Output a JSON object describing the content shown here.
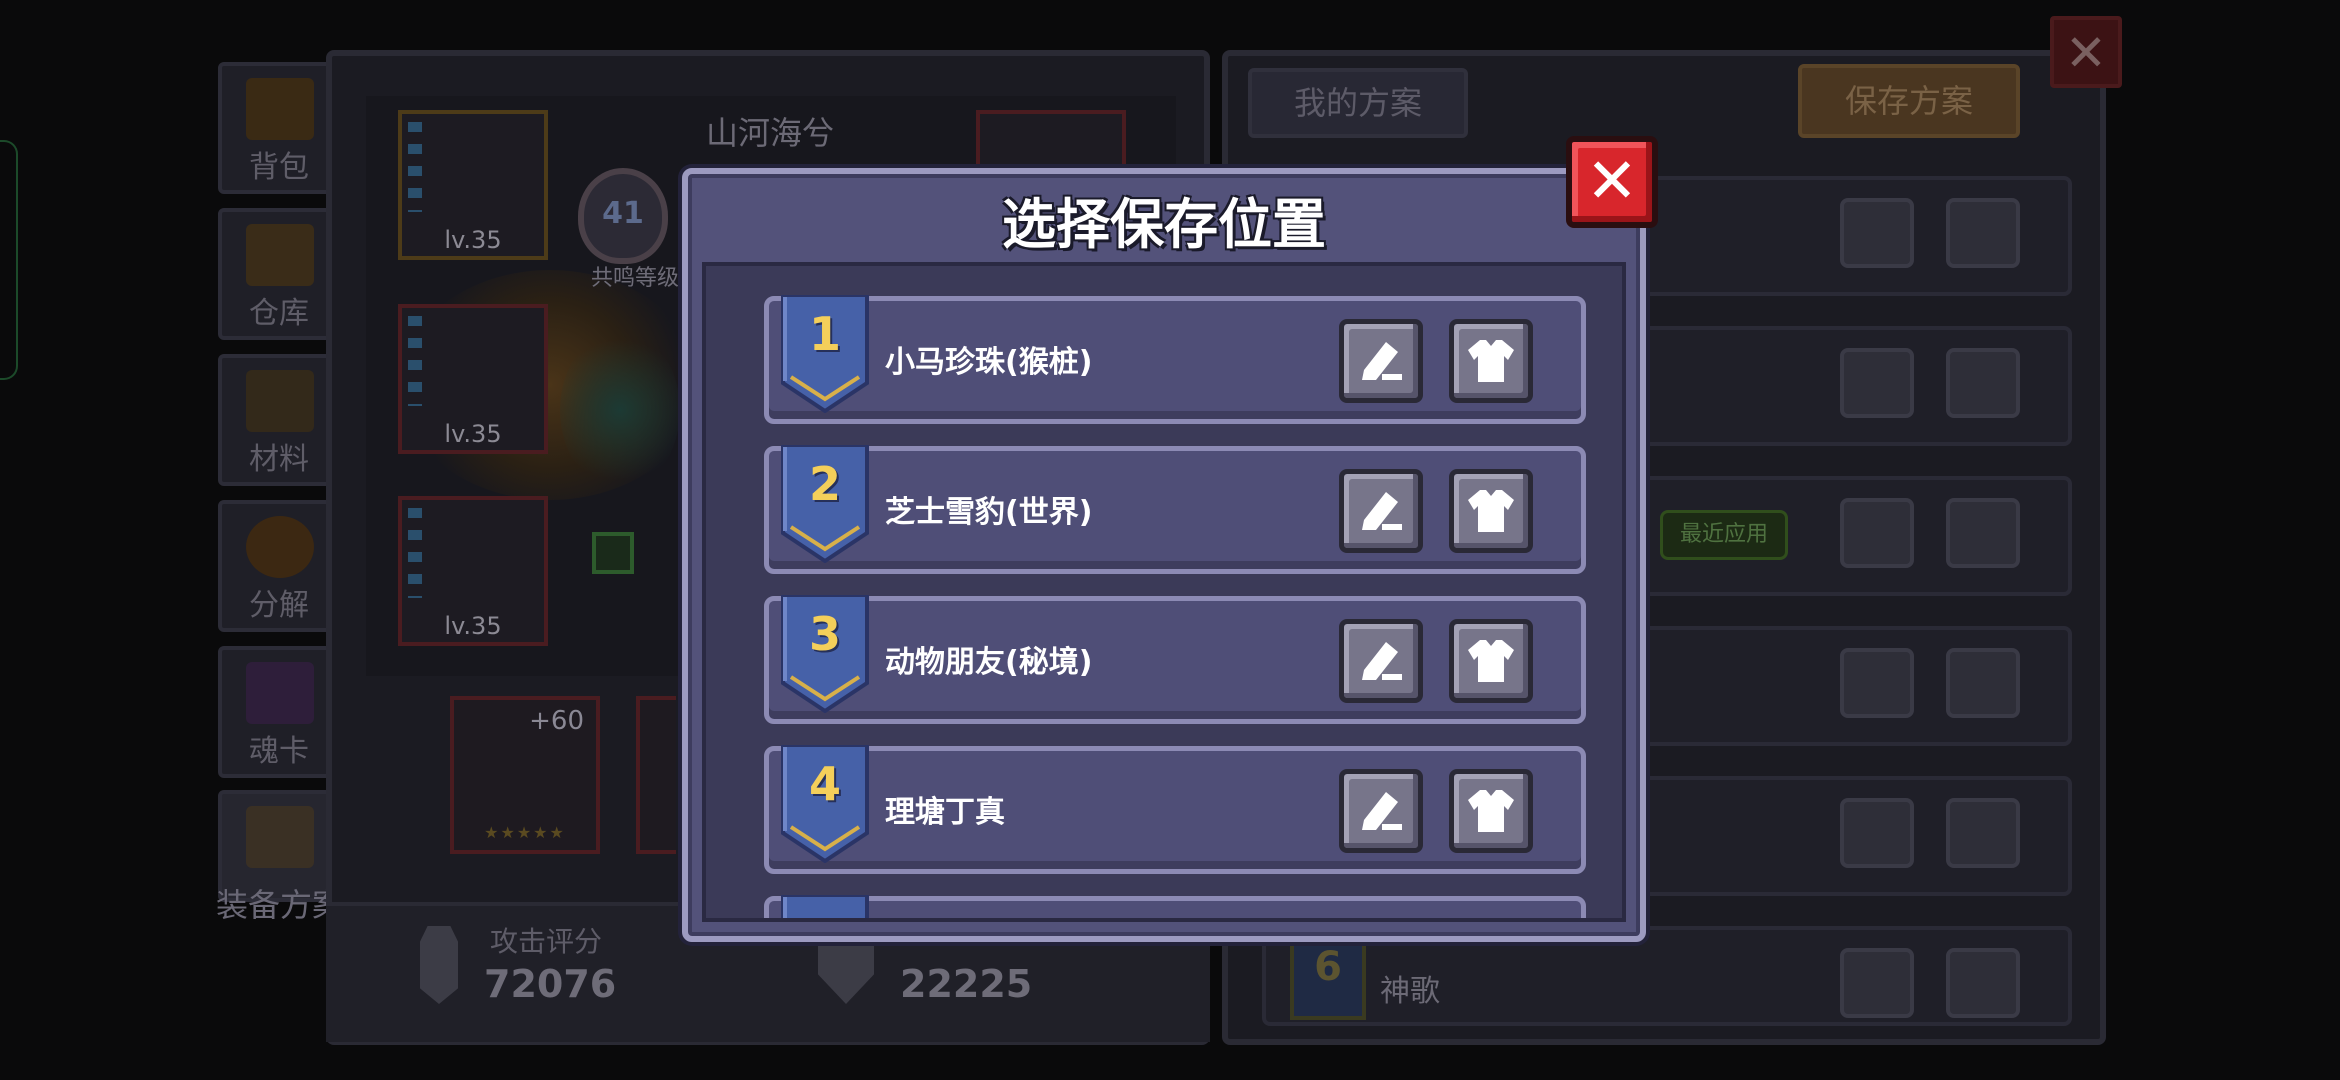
{
  "sidebar": {
    "items": [
      {
        "label": "背包",
        "icon": "chest-icon"
      },
      {
        "label": "仓库",
        "icon": "storage-icon"
      },
      {
        "label": "材料",
        "icon": "material-icon"
      },
      {
        "label": "分解",
        "icon": "pumpkin-icon"
      },
      {
        "label": "魂卡",
        "icon": "soul-card-icon"
      },
      {
        "label": "装备方案",
        "icon": "armor-icon"
      }
    ]
  },
  "character": {
    "name": "山河海兮",
    "resonance_level": "41",
    "resonance_label": "共鸣等级",
    "slots": [
      {
        "level": "lv.35"
      },
      {
        "level": "lv.35"
      },
      {
        "level": "lv.35"
      }
    ],
    "weapon": {
      "plus": "+60",
      "stars": "★★★★★"
    }
  },
  "stats": {
    "attack_label": "攻击评分",
    "attack_value": "72076",
    "defense_label": "",
    "defense_value": "22225"
  },
  "plans_panel": {
    "tab_label": "我的方案",
    "save_button": "保存方案",
    "recent_badge": "最近应用",
    "plan6_number": "6",
    "plan6_name": "神歌"
  },
  "dialog": {
    "title": "选择保存位置",
    "slots": [
      {
        "number": "1",
        "name": "小马珍珠(猴桩)"
      },
      {
        "number": "2",
        "name": "芝士雪豹(世界)"
      },
      {
        "number": "3",
        "name": "动物朋友(秘境)"
      },
      {
        "number": "4",
        "name": "理塘丁真"
      },
      {
        "number": "",
        "name": ""
      }
    ]
  },
  "colors": {
    "dialog_bg": "#53527a",
    "row_bg": "#4f4e77",
    "number_gold": "#f4cf5a",
    "close_red": "#d8262c",
    "shield_blue": "#4661a8"
  }
}
